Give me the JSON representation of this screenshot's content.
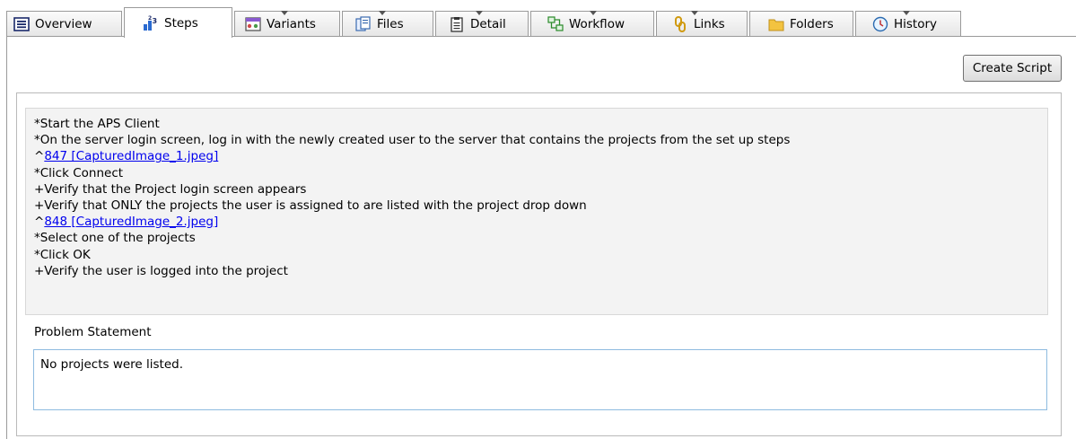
{
  "tabs": [
    {
      "label": "Overview",
      "icon": "overview-icon"
    },
    {
      "label": "Steps",
      "icon": "steps-icon"
    },
    {
      "label": "Variants",
      "icon": "variants-icon"
    },
    {
      "label": "Files",
      "icon": "files-icon"
    },
    {
      "label": "Detail",
      "icon": "detail-icon"
    },
    {
      "label": "Workflow",
      "icon": "workflow-icon"
    },
    {
      "label": "Links",
      "icon": "links-icon"
    },
    {
      "label": "Folders",
      "icon": "folder-icon"
    },
    {
      "label": "History",
      "icon": "history-icon"
    }
  ],
  "toolbar": {
    "create_script_label": "Create Script"
  },
  "steps": {
    "line_1": "*Start the APS Client",
    "line_2": "*On the server login screen, log in with the newly created user to the server that contains the projects from the set up steps",
    "line_3_prefix": "^",
    "line_3_link": "847 [CapturedImage_1.jpeg]",
    "line_4": "*Click Connect",
    "line_5": "+Verify that the Project login screen appears",
    "line_6": "+Verify that ONLY the projects the user is assigned to are listed with the project drop down",
    "line_7_prefix": "^",
    "line_7_link": "848 [CapturedImage_2.jpeg]",
    "line_8": "*Select one of the projects",
    "line_9": "*Click OK",
    "line_10": "+Verify the user is logged into the project"
  },
  "problem_statement": {
    "label": "Problem Statement",
    "value": "No projects were listed."
  },
  "colors": {
    "link": "#0000ee",
    "field_border": "#8ebbe0",
    "steps_bg": "#f3f3f3"
  }
}
